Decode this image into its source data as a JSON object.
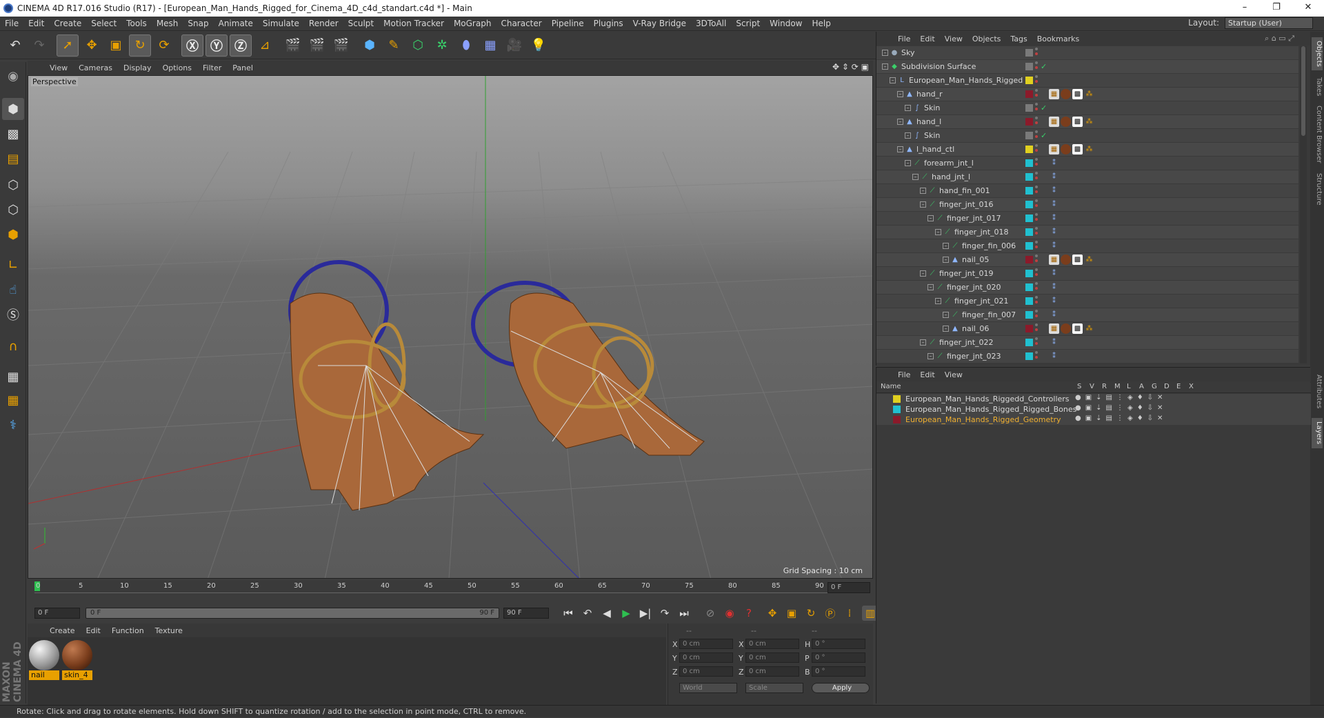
{
  "window": {
    "title": "CINEMA 4D R17.016 Studio (R17) - [European_Man_Hands_Rigged_for_Cinema_4D_c4d_standart.c4d *] - Main",
    "minimize": "–",
    "restore": "❐",
    "close": "✕"
  },
  "menubar": {
    "items": [
      "File",
      "Edit",
      "Create",
      "Select",
      "Tools",
      "Mesh",
      "Snap",
      "Animate",
      "Simulate",
      "Render",
      "Sculpt",
      "Motion Tracker",
      "MoGraph",
      "Character",
      "Pipeline",
      "Plugins",
      "V-Ray Bridge",
      "3DToAll",
      "Script",
      "Window",
      "Help"
    ],
    "layout_label": "Layout:",
    "layout_value": "Startup (User)"
  },
  "viewport": {
    "menu": [
      "View",
      "Cameras",
      "Display",
      "Options",
      "Filter",
      "Panel"
    ],
    "label": "Perspective",
    "grid_spacing": "Grid Spacing : 10 cm"
  },
  "timeline": {
    "ticks": [
      "0",
      "5",
      "10",
      "15",
      "20",
      "25",
      "30",
      "35",
      "40",
      "45",
      "50",
      "55",
      "60",
      "65",
      "70",
      "75",
      "80",
      "85",
      "90"
    ],
    "frame_end_field": "0 F",
    "start_field": "0 F",
    "range_start": "0 F",
    "range_end": "90 F",
    "end_field": "90 F"
  },
  "material_manager": {
    "menu": [
      "Create",
      "Edit",
      "Function",
      "Texture"
    ],
    "materials": [
      {
        "name": "nail",
        "color": "#b9b9b9"
      },
      {
        "name": "skin_4",
        "color": "#7a3d1c"
      }
    ]
  },
  "coordinates": {
    "header": [
      "--",
      "--",
      "--"
    ],
    "rows": [
      {
        "a": "X",
        "av": "0 cm",
        "b": "X",
        "bv": "0 cm",
        "c": "H",
        "cv": "0 °"
      },
      {
        "a": "Y",
        "av": "0 cm",
        "b": "Y",
        "bv": "0 cm",
        "c": "P",
        "cv": "0 °"
      },
      {
        "a": "Z",
        "av": "0 cm",
        "b": "Z",
        "bv": "0 cm",
        "c": "B",
        "cv": "0 °"
      }
    ],
    "mode1": "World",
    "mode2": "Scale",
    "apply": "Apply"
  },
  "object_manager": {
    "menu": [
      "File",
      "Edit",
      "View",
      "Objects",
      "Tags",
      "Bookmarks"
    ],
    "objects": [
      {
        "name": "Sky",
        "level": 0,
        "icon": "sky-icon",
        "swatch": "#7a7a7a",
        "check": ""
      },
      {
        "name": "Subdivision Surface",
        "level": 0,
        "icon": "subdivision-icon",
        "swatch": "#7a7a7a",
        "check": "✓"
      },
      {
        "name": "European_Man_Hands_Rigged",
        "level": 1,
        "icon": "null-icon",
        "swatch": "#e0d020",
        "check": ""
      },
      {
        "name": "hand_r",
        "level": 2,
        "icon": "polygon-icon",
        "swatch": "#8b1a2a",
        "check": ""
      },
      {
        "name": "Skin",
        "level": 3,
        "icon": "skin-icon",
        "swatch": "#7a7a7a",
        "check": "✓"
      },
      {
        "name": "hand_l",
        "level": 2,
        "icon": "polygon-icon",
        "swatch": "#8b1a2a",
        "check": ""
      },
      {
        "name": "Skin",
        "level": 3,
        "icon": "skin-icon",
        "swatch": "#7a7a7a",
        "check": "✓"
      },
      {
        "name": "l_hand_ctl",
        "level": 2,
        "icon": "polygon-icon",
        "swatch": "#e0d020",
        "check": ""
      },
      {
        "name": "forearm_jnt_l",
        "level": 3,
        "icon": "joint-icon",
        "swatch": "#20c0d0",
        "check": ""
      },
      {
        "name": "hand_jnt_l",
        "level": 4,
        "icon": "joint-icon",
        "swatch": "#20c0d0",
        "check": ""
      },
      {
        "name": "hand_fin_001",
        "level": 5,
        "icon": "joint-icon",
        "swatch": "#20c0d0",
        "check": ""
      },
      {
        "name": "finger_jnt_016",
        "level": 5,
        "icon": "joint-icon",
        "swatch": "#20c0d0",
        "check": ""
      },
      {
        "name": "finger_jnt_017",
        "level": 6,
        "icon": "joint-icon",
        "swatch": "#20c0d0",
        "check": ""
      },
      {
        "name": "finger_jnt_018",
        "level": 7,
        "icon": "joint-icon",
        "swatch": "#20c0d0",
        "check": ""
      },
      {
        "name": "finger_fin_006",
        "level": 8,
        "icon": "joint-icon",
        "swatch": "#20c0d0",
        "check": ""
      },
      {
        "name": "nail_05",
        "level": 8,
        "icon": "polygon-icon",
        "swatch": "#8b1a2a",
        "check": ""
      },
      {
        "name": "finger_jnt_019",
        "level": 5,
        "icon": "joint-icon",
        "swatch": "#20c0d0",
        "check": ""
      },
      {
        "name": "finger_jnt_020",
        "level": 6,
        "icon": "joint-icon",
        "swatch": "#20c0d0",
        "check": ""
      },
      {
        "name": "finger_jnt_021",
        "level": 7,
        "icon": "joint-icon",
        "swatch": "#20c0d0",
        "check": ""
      },
      {
        "name": "finger_fin_007",
        "level": 8,
        "icon": "joint-icon",
        "swatch": "#20c0d0",
        "check": ""
      },
      {
        "name": "nail_06",
        "level": 8,
        "icon": "polygon-icon",
        "swatch": "#8b1a2a",
        "check": ""
      },
      {
        "name": "finger_jnt_022",
        "level": 5,
        "icon": "joint-icon",
        "swatch": "#20c0d0",
        "check": ""
      },
      {
        "name": "finger_jnt_023",
        "level": 6,
        "icon": "joint-icon",
        "swatch": "#20c0d0",
        "check": ""
      }
    ]
  },
  "layer_manager": {
    "menu": [
      "File",
      "Edit",
      "View"
    ],
    "name_header": "Name",
    "columns": [
      "S",
      "V",
      "R",
      "M",
      "L",
      "A",
      "G",
      "D",
      "E",
      "X"
    ],
    "layers": [
      {
        "name": "European_Man_Hands_Riggedd_Controllers",
        "color": "#e0d020",
        "text_color": "#d8d8d8"
      },
      {
        "name": "European_Man_Hands_Rigged_Rigged_Bones",
        "color": "#20c0d0",
        "text_color": "#d8d8d8"
      },
      {
        "name": "European_Man_Hands_Rigged_Geometry",
        "color": "#8b1a2a",
        "text_color": "#f0b030"
      }
    ]
  },
  "right_tabs": [
    "Objects",
    "Takes",
    "Content Browser",
    "Structure",
    "Attributes",
    "Layers"
  ],
  "status": "Rotate: Click and drag to rotate elements. Hold down SHIFT to quantize rotation / add to the selection in point mode, CTRL to remove.",
  "brand": "MAXON CINEMA 4D"
}
